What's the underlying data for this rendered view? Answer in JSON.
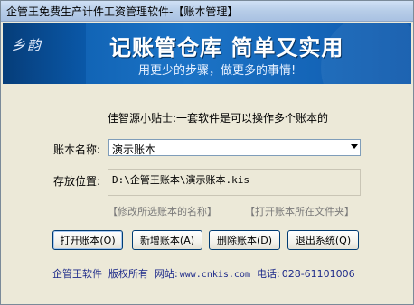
{
  "window": {
    "title": "企管王免费生产计件工资管理软件-【账本管理】"
  },
  "banner": {
    "logo_text": "乡韵",
    "slogan": "记账管仓库 简单又实用",
    "subtitle": "用更少的步骤，做更多的事情!"
  },
  "tip": "佳智源小贴士:一套软件是可以操作多个账本的",
  "account": {
    "name_label": "账本名称:",
    "name_value": "演示账本",
    "path_label": "存放位置:",
    "path_value": "D:\\企管王账本\\演示账本.kis"
  },
  "links": {
    "rename": "【修改所选账本的名称】",
    "open_folder": "【打开账本所在文件夹】"
  },
  "buttons": {
    "open": "打开账本(O)",
    "new": "新增账本(A)",
    "delete": "删除账本(D)",
    "exit": "退出系统(Q)"
  },
  "footer": {
    "company": "企管王软件",
    "rights": "版权所有",
    "site_label": "网站:",
    "site": "www.cnkis.com",
    "phone_label": "电话:",
    "phone": "028-61101006"
  }
}
